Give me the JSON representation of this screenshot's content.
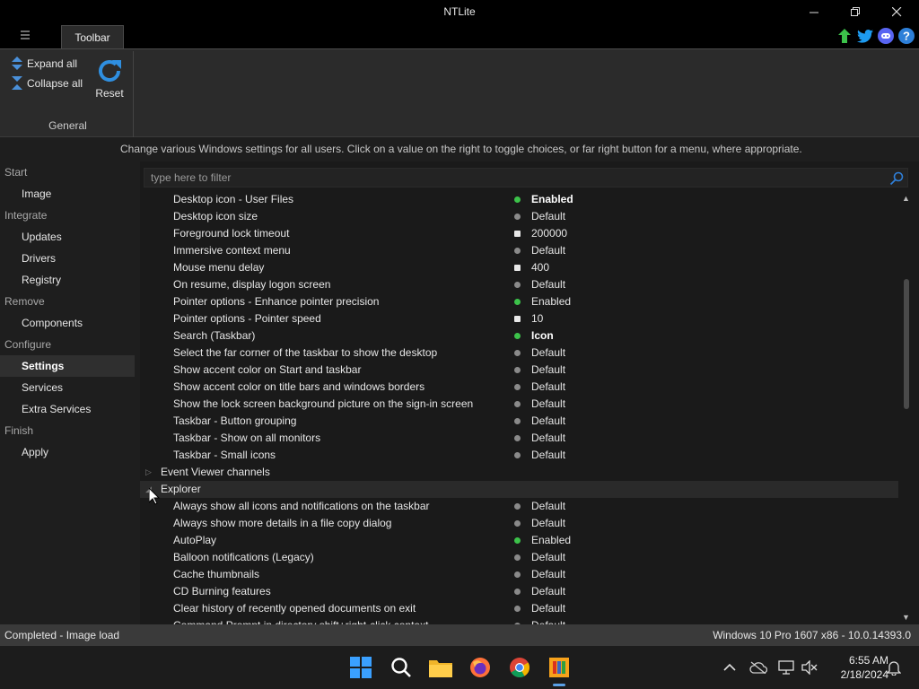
{
  "window": {
    "title": "NTLite"
  },
  "ribbon": {
    "tab_label": "Toolbar",
    "expand_all": "Expand all",
    "collapse_all": "Collapse all",
    "reset": "Reset",
    "group_label": "General"
  },
  "info_text": "Change various Windows settings for all users. Click on a value on the right to toggle choices, or far right button for a menu, where appropriate.",
  "filter": {
    "placeholder": "type here to filter"
  },
  "sidebar": {
    "sections": [
      {
        "header": "Start",
        "items": [
          "Image"
        ]
      },
      {
        "header": "Integrate",
        "items": [
          "Updates",
          "Drivers",
          "Registry"
        ]
      },
      {
        "header": "Remove",
        "items": [
          "Components"
        ]
      },
      {
        "header": "Configure",
        "items": [
          "Settings",
          "Services",
          "Extra Services"
        ]
      },
      {
        "header": "Finish",
        "items": [
          "Apply"
        ]
      }
    ],
    "active_item": "Settings"
  },
  "settings_rows": [
    {
      "name": "Desktop icon - User Files",
      "value": "Enabled",
      "indicator": "green",
      "bold": true
    },
    {
      "name": "Desktop icon size",
      "value": "Default",
      "indicator": "gray",
      "bold": false
    },
    {
      "name": "Foreground lock timeout",
      "value": "200000",
      "indicator": "square",
      "bold": false
    },
    {
      "name": "Immersive context menu",
      "value": "Default",
      "indicator": "gray",
      "bold": false
    },
    {
      "name": "Mouse menu delay",
      "value": "400",
      "indicator": "square",
      "bold": false
    },
    {
      "name": "On resume, display logon screen",
      "value": "Default",
      "indicator": "gray",
      "bold": false
    },
    {
      "name": "Pointer options - Enhance pointer precision",
      "value": "Enabled",
      "indicator": "green",
      "bold": false
    },
    {
      "name": "Pointer options - Pointer speed",
      "value": "10",
      "indicator": "square",
      "bold": false
    },
    {
      "name": "Search (Taskbar)",
      "value": "Icon",
      "indicator": "green",
      "bold": true
    },
    {
      "name": "Select the far corner of the taskbar to show the desktop",
      "value": "Default",
      "indicator": "gray",
      "bold": false
    },
    {
      "name": "Show accent color on Start and taskbar",
      "value": "Default",
      "indicator": "gray",
      "bold": false
    },
    {
      "name": "Show accent color on title bars and windows borders",
      "value": "Default",
      "indicator": "gray",
      "bold": false
    },
    {
      "name": "Show the lock screen background picture on the sign-in screen",
      "value": "Default",
      "indicator": "gray",
      "bold": false
    },
    {
      "name": "Taskbar - Button grouping",
      "value": "Default",
      "indicator": "gray",
      "bold": false
    },
    {
      "name": "Taskbar - Show on all monitors",
      "value": "Default",
      "indicator": "gray",
      "bold": false
    },
    {
      "name": "Taskbar - Small icons",
      "value": "Default",
      "indicator": "gray",
      "bold": false
    }
  ],
  "groups": {
    "event_viewer": "Event Viewer channels",
    "explorer": "Explorer"
  },
  "explorer_rows": [
    {
      "name": "Always show all icons and notifications on the taskbar",
      "value": "Default",
      "indicator": "gray"
    },
    {
      "name": "Always show more details in a file copy dialog",
      "value": "Default",
      "indicator": "gray"
    },
    {
      "name": "AutoPlay",
      "value": "Enabled",
      "indicator": "green"
    },
    {
      "name": "Balloon notifications (Legacy)",
      "value": "Default",
      "indicator": "gray"
    },
    {
      "name": "Cache thumbnails",
      "value": "Default",
      "indicator": "gray"
    },
    {
      "name": "CD Burning features",
      "value": "Default",
      "indicator": "gray"
    },
    {
      "name": "Clear history of recently opened documents on exit",
      "value": "Default",
      "indicator": "gray"
    },
    {
      "name": "Command Prompt in directory shift+right-click context",
      "value": "Default",
      "indicator": "gray"
    }
  ],
  "status": {
    "left": "Completed - Image load",
    "right": "Windows 10 Pro 1607 x86 - 10.0.14393.0"
  },
  "taskbar": {
    "time": "6:55 AM",
    "date": "2/18/2024"
  },
  "colors": {
    "enabled_dot": "#3cc24a",
    "default_dot": "#8a8a8a",
    "accent": "#5aa0e6"
  }
}
